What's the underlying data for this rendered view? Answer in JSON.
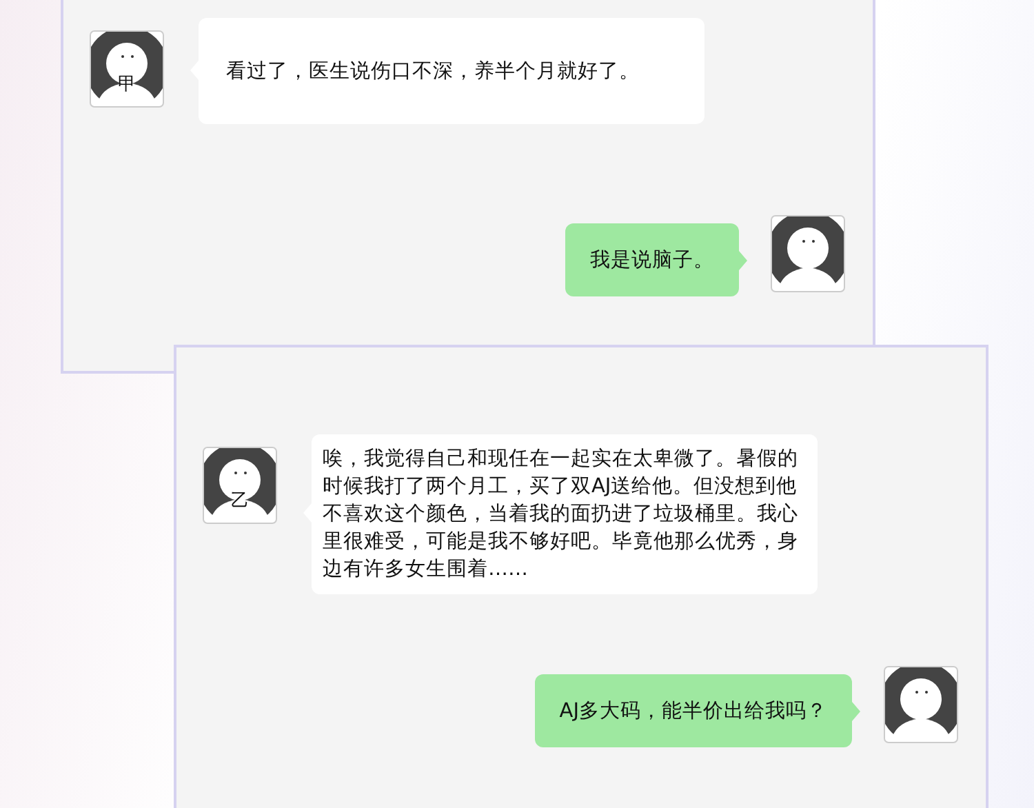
{
  "panels": [
    {
      "messages": [
        {
          "kind": "received",
          "avatar_label": "甲",
          "text": "看过了，医生说伤口不深，养半个月就好了。"
        },
        {
          "kind": "sent",
          "text": "我是说脑子。"
        }
      ]
    },
    {
      "messages": [
        {
          "kind": "received",
          "avatar_label": "乙",
          "text": "唉，我觉得自己和现任在一起实在太卑微了。暑假的时候我打了两个月工，买了双AJ送给他。但没想到他不喜欢这个颜色，当着我的面扔进了垃圾桶里。我心里很难受，可能是我不够好吧。毕竟他那么优秀，身边有许多女生围着……"
        },
        {
          "kind": "sent",
          "text": "AJ多大码，能半价出给我吗？"
        }
      ]
    }
  ]
}
